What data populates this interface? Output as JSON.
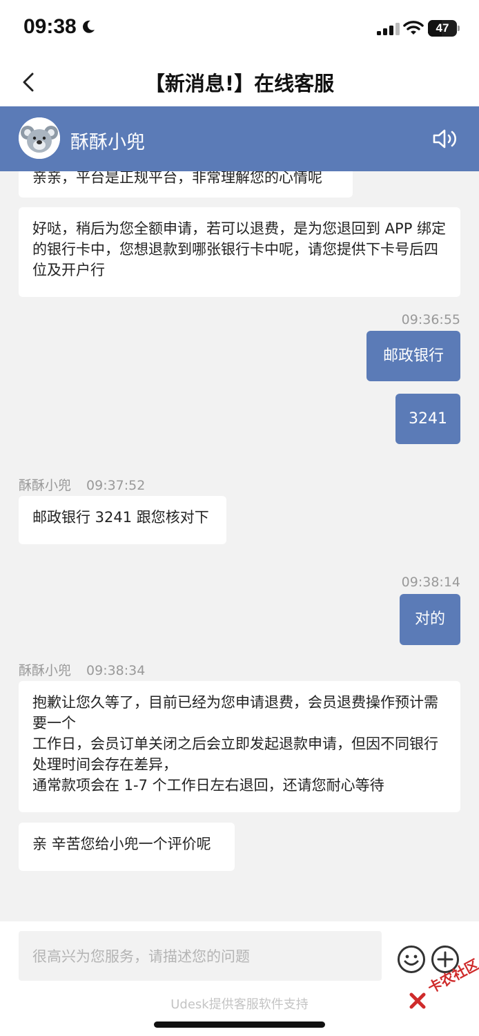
{
  "status_bar": {
    "time": "09:38",
    "battery": "47",
    "battery_level": 0.47
  },
  "nav": {
    "title": "【新消息!】在线客服"
  },
  "agent": {
    "name": "酥酥小兜"
  },
  "messages": {
    "m0": {
      "text": "亲亲，平台是正规平台，非常理解您的心情呢"
    },
    "m1": {
      "text": "好哒，稍后为您全额申请，若可以退费，是为您退回到 APP 绑定的银行卡中，您想退款到哪张银行卡中呢，请您提供下卡号后四位及开户行"
    },
    "t1": {
      "time": "09:36:55"
    },
    "m2": {
      "text": "邮政银行"
    },
    "m3": {
      "text": "3241"
    },
    "meta1": {
      "sender": "酥酥小兜",
      "time": "09:37:52"
    },
    "m4": {
      "text": "邮政银行 3241 跟您核对下"
    },
    "t2": {
      "time": "09:38:14"
    },
    "m5": {
      "text": "对的"
    },
    "meta2": {
      "sender": "酥酥小兜",
      "time": "09:38:34"
    },
    "m6": {
      "line1": "抱歉让您久等了，目前已经为您申请退费，会员退费操作预计需要一个",
      "line2": "工作日，会员订单关闭之后会立即发起退款申请，但因不同银行处理时间会存在差异，",
      "line3": "通常款项会在 1-7 个工作日左右退回，还请您耐心等待"
    },
    "m7": {
      "text": "亲 辛苦您给小兜一个评价呢"
    }
  },
  "input": {
    "placeholder": "很高兴为您服务，请描述您的问题"
  },
  "footer": {
    "text": "Udesk提供客服软件支持"
  },
  "watermark": {
    "text": "卡农社区"
  },
  "colors": {
    "header_blue": "#5b7bb7",
    "background": "#f2f2f2",
    "bubble_left": "#ffffff",
    "bubble_right": "#5b7bb7"
  },
  "icons": [
    "moon-icon",
    "signal-icon",
    "wifi-icon",
    "battery-icon",
    "back-icon",
    "koala-avatar",
    "speaker-icon",
    "emoji-icon",
    "plus-icon"
  ]
}
